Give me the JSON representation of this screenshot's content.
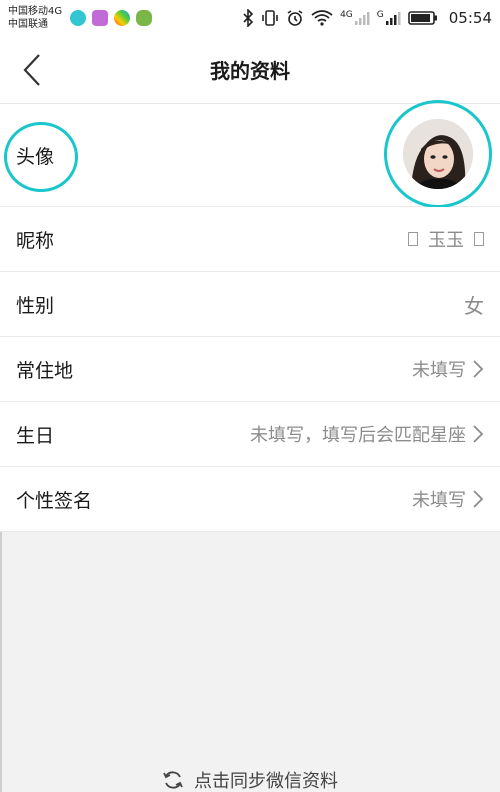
{
  "status_bar": {
    "carrier_1": "中国移动4G",
    "carrier_2": "中国联通",
    "net_1": "4G",
    "net_2": "G",
    "time": "05:54"
  },
  "header": {
    "title": "我的资料"
  },
  "profile": {
    "rows": [
      {
        "label": "头像",
        "value": ""
      },
      {
        "label": "昵称",
        "value": "玉玉"
      },
      {
        "label": "性别",
        "value": "女"
      },
      {
        "label": "常住地",
        "value": "未填写"
      },
      {
        "label": "生日",
        "value": "未填写，填写后会匹配星座"
      },
      {
        "label": "个性签名",
        "value": "未填写"
      }
    ],
    "nickname_glyph_left": "𓆝",
    "nickname_glyph_right": "𓆝"
  },
  "footer": {
    "sync_label": "点击同步微信资料"
  },
  "colors": {
    "highlight": "#19c6cc",
    "muted_text": "#8c8c8c"
  },
  "icons": {
    "back": "chevron-left-icon",
    "chevron": "chevron-right-icon",
    "sync": "sync-icon"
  }
}
